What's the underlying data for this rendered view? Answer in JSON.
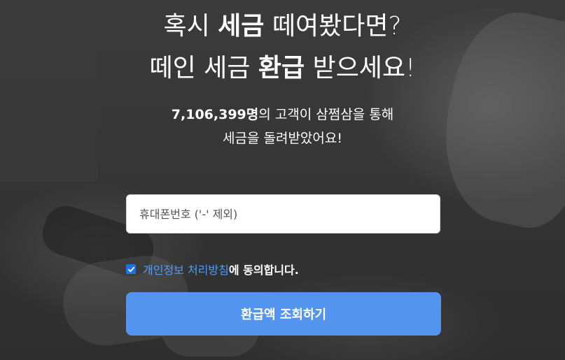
{
  "headline": {
    "line1_pre": "혹시 ",
    "line1_strong": "세금",
    "line1_post": " 떼여봤다면?",
    "line2_pre": "떼인 세금 ",
    "line2_strong": "환급",
    "line2_post": " 받으세요!"
  },
  "subtext": {
    "count": "7,106,399명",
    "line1_rest": "의 고객이 삼쩜삼을 통해",
    "line2": "세금을 돌려받았어요!"
  },
  "form": {
    "phone_placeholder": "휴대폰번호 ('-' 제외)",
    "phone_value": "",
    "agree_link": "개인정보 처리방침",
    "agree_suffix": "에 동의합니다.",
    "agree_checked": true,
    "submit_label": "환급액 조회하기"
  },
  "colors": {
    "accent": "#5395ee",
    "link": "#4f9cf5",
    "checkbox": "#1a73e8"
  },
  "icons": {
    "checkbox": "checkmark-icon"
  }
}
